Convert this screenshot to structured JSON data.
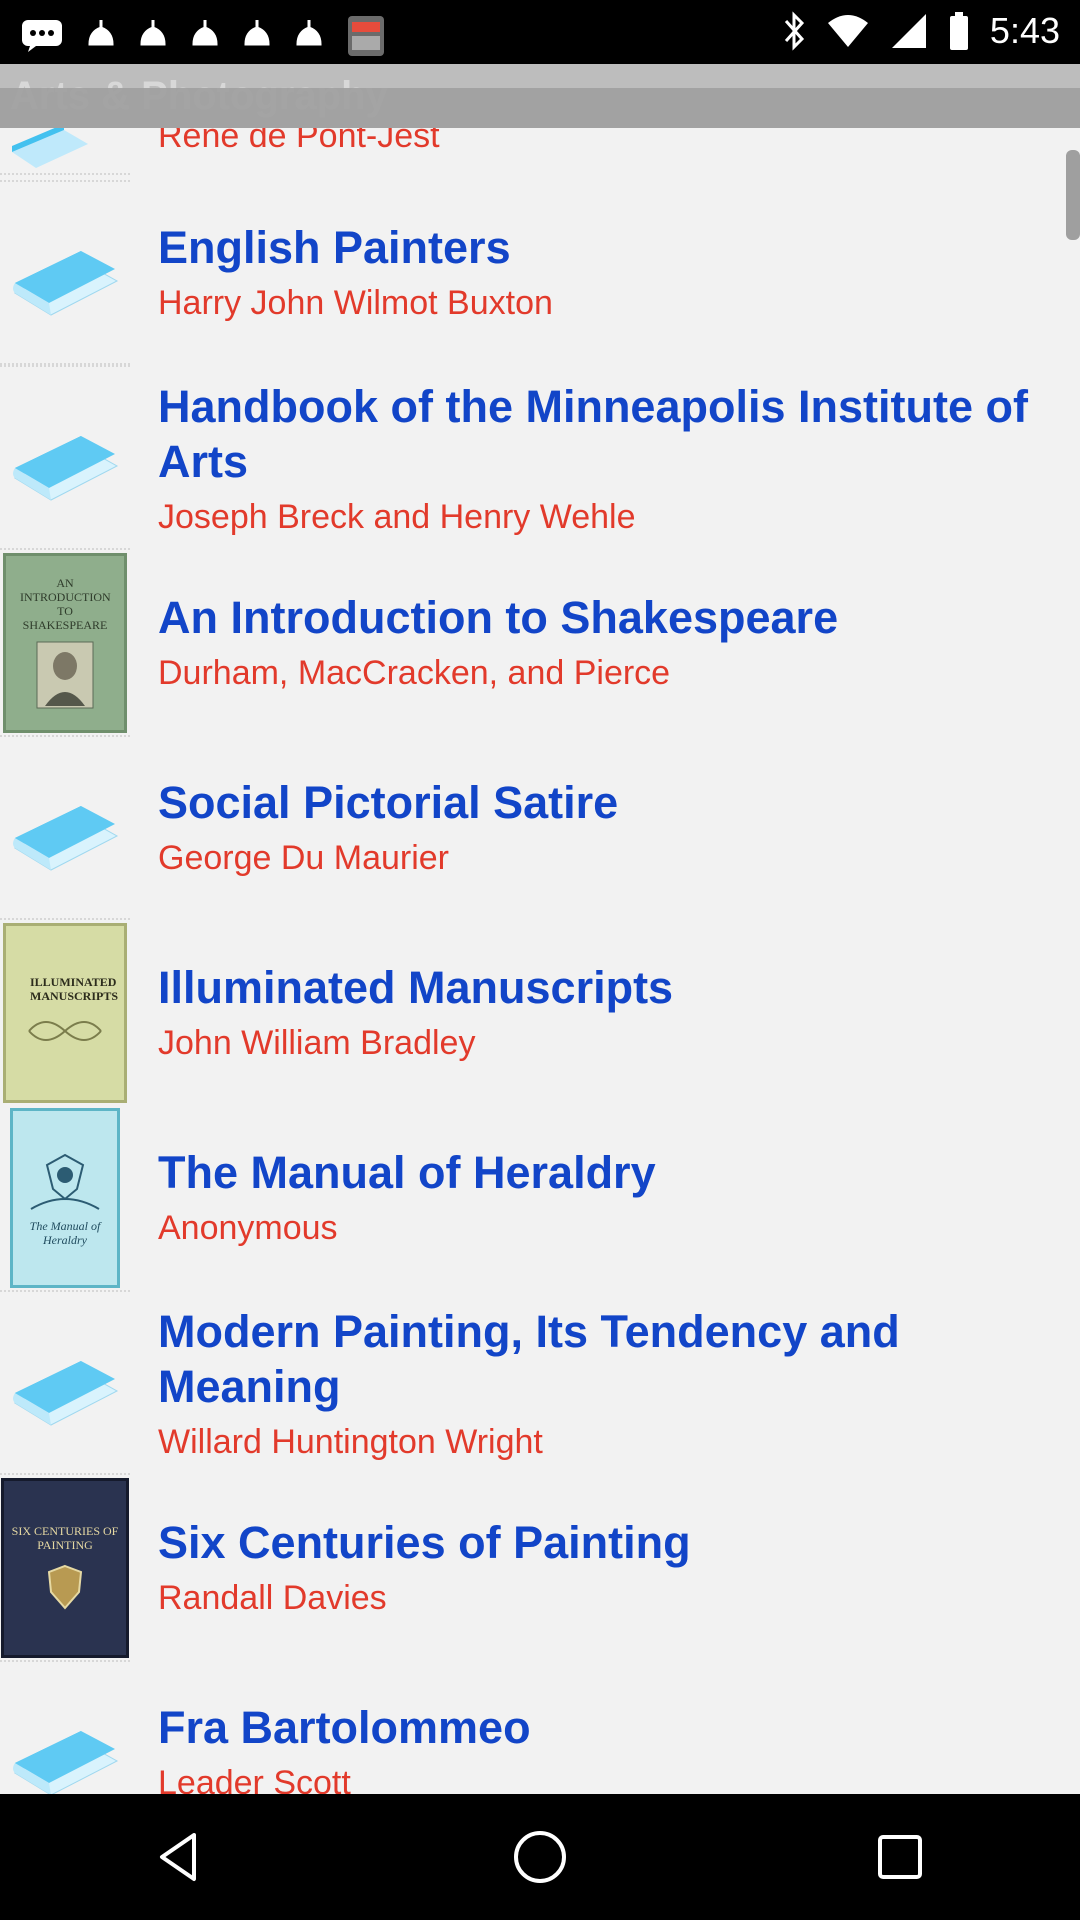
{
  "status_bar": {
    "time": "5:43",
    "left_icons": [
      "chat-icon",
      "notification-icon",
      "notification-icon",
      "notification-icon",
      "notification-icon",
      "notification-icon",
      "news-app-icon"
    ],
    "right_icons": [
      "bluetooth-icon",
      "wifi-icon",
      "signal-icon",
      "battery-icon"
    ]
  },
  "app_bar": {
    "title": "Arts & Photography"
  },
  "partial_top": {
    "author": "René de Pont-Jest"
  },
  "books": [
    {
      "title": "English Painters",
      "author": "Harry John Wilmot Buxton",
      "thumb": "default"
    },
    {
      "title": "Handbook of the Minneapolis Institute of Arts",
      "author": "Joseph Breck and Henry Wehle",
      "thumb": "default"
    },
    {
      "title": "An Introduction to Shakespeare",
      "author": "Durham, MacCracken, and Pierce",
      "thumb": "cover",
      "cover_text": "AN INTRODUCTION TO SHAKESPEARE"
    },
    {
      "title": "Social Pictorial Satire",
      "author": "George Du Maurier",
      "thumb": "default"
    },
    {
      "title": "Illuminated Manuscripts",
      "author": "John William Bradley",
      "thumb": "cover",
      "cover_text": "ILLUMINATED MANUSCRIPTS"
    },
    {
      "title": "The Manual of Heraldry",
      "author": "Anonymous",
      "thumb": "cover",
      "cover_text": "The Manual of Heraldry"
    },
    {
      "title": "Modern Painting, Its Tendency and Meaning",
      "author": "Willard Huntington Wright",
      "thumb": "default"
    },
    {
      "title": "Six Centuries of Painting",
      "author": "Randall Davies",
      "thumb": "cover",
      "cover_text": "SIX CENTURIES OF PAINTING"
    },
    {
      "title": "Fra Bartolommeo",
      "author": "Leader Scott",
      "thumb": "default"
    }
  ],
  "colors": {
    "title": "#1245c8",
    "author": "#e23a2b",
    "background": "#f2f2f2"
  },
  "nav": {
    "back": "back-icon",
    "home": "home-icon",
    "recents": "recents-icon"
  }
}
